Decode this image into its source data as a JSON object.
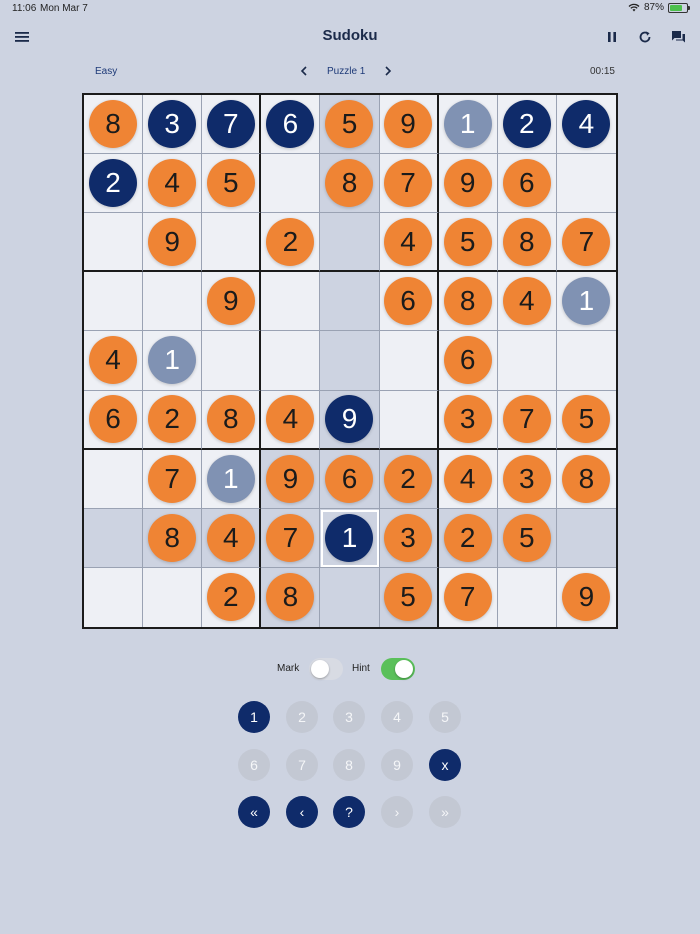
{
  "status_bar": {
    "time": "11:06",
    "date": "Mon Mar 7",
    "battery": "87%",
    "battery_level": 0.87
  },
  "header": {
    "title": "Sudoku",
    "menu_icon": "menu-icon",
    "pause_icon": "pause-icon",
    "restart_icon": "refresh-icon",
    "chat_icon": "chat-icon"
  },
  "sub_header": {
    "difficulty": "Easy",
    "puzzle": "Puzzle 1",
    "timer": "00:15",
    "prev_icon": "chevron-left-icon",
    "next_icon": "chevron-right-icon"
  },
  "board": {
    "rows": [
      [
        {
          "v": "8",
          "c": "orange"
        },
        {
          "v": "3",
          "c": "navy"
        },
        {
          "v": "7",
          "c": "navy"
        },
        {
          "v": "6",
          "c": "navy"
        },
        {
          "v": "5",
          "c": "orange"
        },
        {
          "v": "9",
          "c": "orange"
        },
        {
          "v": "1",
          "c": "slate"
        },
        {
          "v": "2",
          "c": "navy"
        },
        {
          "v": "4",
          "c": "navy"
        }
      ],
      [
        {
          "v": "2",
          "c": "navy"
        },
        {
          "v": "4",
          "c": "orange"
        },
        {
          "v": "5",
          "c": "orange"
        },
        {
          "v": "",
          "c": ""
        },
        {
          "v": "8",
          "c": "orange"
        },
        {
          "v": "7",
          "c": "orange"
        },
        {
          "v": "9",
          "c": "orange"
        },
        {
          "v": "6",
          "c": "orange"
        },
        {
          "v": "",
          "c": ""
        }
      ],
      [
        {
          "v": "",
          "c": ""
        },
        {
          "v": "9",
          "c": "orange"
        },
        {
          "v": "",
          "c": ""
        },
        {
          "v": "2",
          "c": "orange"
        },
        {
          "v": "",
          "c": ""
        },
        {
          "v": "4",
          "c": "orange"
        },
        {
          "v": "5",
          "c": "orange"
        },
        {
          "v": "8",
          "c": "orange"
        },
        {
          "v": "7",
          "c": "orange"
        }
      ],
      [
        {
          "v": "",
          "c": ""
        },
        {
          "v": "",
          "c": ""
        },
        {
          "v": "9",
          "c": "orange"
        },
        {
          "v": "",
          "c": ""
        },
        {
          "v": "",
          "c": ""
        },
        {
          "v": "6",
          "c": "orange"
        },
        {
          "v": "8",
          "c": "orange"
        },
        {
          "v": "4",
          "c": "orange"
        },
        {
          "v": "1",
          "c": "slate"
        }
      ],
      [
        {
          "v": "4",
          "c": "orange"
        },
        {
          "v": "1",
          "c": "slate"
        },
        {
          "v": "",
          "c": ""
        },
        {
          "v": "",
          "c": ""
        },
        {
          "v": "",
          "c": ""
        },
        {
          "v": "",
          "c": ""
        },
        {
          "v": "6",
          "c": "orange"
        },
        {
          "v": "",
          "c": ""
        },
        {
          "v": "",
          "c": ""
        }
      ],
      [
        {
          "v": "6",
          "c": "orange"
        },
        {
          "v": "2",
          "c": "orange"
        },
        {
          "v": "8",
          "c": "orange"
        },
        {
          "v": "4",
          "c": "orange"
        },
        {
          "v": "9",
          "c": "navy"
        },
        {
          "v": "",
          "c": ""
        },
        {
          "v": "3",
          "c": "orange"
        },
        {
          "v": "7",
          "c": "orange"
        },
        {
          "v": "5",
          "c": "orange"
        }
      ],
      [
        {
          "v": "",
          "c": ""
        },
        {
          "v": "7",
          "c": "orange"
        },
        {
          "v": "1",
          "c": "slate"
        },
        {
          "v": "9",
          "c": "orange"
        },
        {
          "v": "6",
          "c": "orange"
        },
        {
          "v": "2",
          "c": "orange"
        },
        {
          "v": "4",
          "c": "orange"
        },
        {
          "v": "3",
          "c": "orange"
        },
        {
          "v": "8",
          "c": "orange"
        }
      ],
      [
        {
          "v": "",
          "c": ""
        },
        {
          "v": "8",
          "c": "orange"
        },
        {
          "v": "4",
          "c": "orange"
        },
        {
          "v": "7",
          "c": "orange"
        },
        {
          "v": "1",
          "c": "navy"
        },
        {
          "v": "3",
          "c": "orange"
        },
        {
          "v": "2",
          "c": "orange"
        },
        {
          "v": "5",
          "c": "orange"
        },
        {
          "v": "",
          "c": ""
        }
      ],
      [
        {
          "v": "",
          "c": ""
        },
        {
          "v": "",
          "c": ""
        },
        {
          "v": "2",
          "c": "orange"
        },
        {
          "v": "8",
          "c": "orange"
        },
        {
          "v": "",
          "c": ""
        },
        {
          "v": "5",
          "c": "orange"
        },
        {
          "v": "7",
          "c": "orange"
        },
        {
          "v": "",
          "c": ""
        },
        {
          "v": "9",
          "c": "orange"
        }
      ]
    ],
    "selected": {
      "row": 7,
      "col": 4
    }
  },
  "toggles": {
    "mark_label": "Mark",
    "mark_on": false,
    "hint_label": "Hint",
    "hint_on": true
  },
  "keypad": {
    "row1": [
      {
        "label": "1",
        "active": true
      },
      {
        "label": "2",
        "active": false
      },
      {
        "label": "3",
        "active": false
      },
      {
        "label": "4",
        "active": false
      },
      {
        "label": "5",
        "active": false
      }
    ],
    "row2": [
      {
        "label": "6",
        "active": false
      },
      {
        "label": "7",
        "active": false
      },
      {
        "label": "8",
        "active": false
      },
      {
        "label": "9",
        "active": false
      },
      {
        "label": "x",
        "active": true
      }
    ],
    "row3": [
      {
        "label": "«",
        "active": true
      },
      {
        "label": "‹",
        "active": true
      },
      {
        "label": "?",
        "active": true
      },
      {
        "label": "›",
        "active": false
      },
      {
        "label": "»",
        "active": false
      }
    ]
  },
  "colors": {
    "orange": "#ef8434",
    "navy": "#0f2b6a",
    "slate": "#8092b3",
    "background": "#cdd3e1",
    "toggle_on": "#5ac05a"
  }
}
